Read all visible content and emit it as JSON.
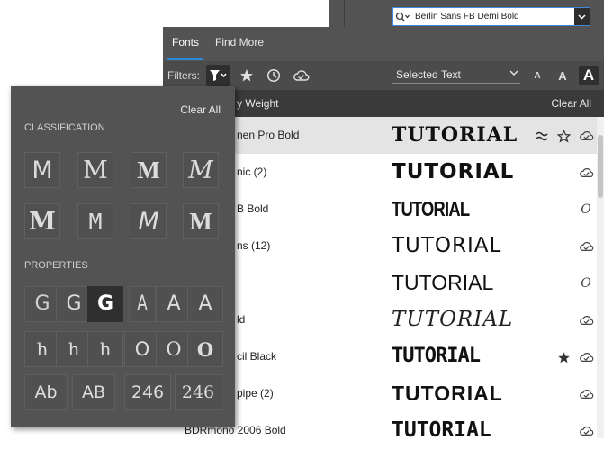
{
  "font_search": {
    "value": "Berlin Sans FB Demi Bold"
  },
  "tabs": [
    {
      "label": "Fonts",
      "active": true
    },
    {
      "label": "Find More",
      "active": false
    }
  ],
  "filters": {
    "label": "Filters:",
    "sample_text": "Selected Text",
    "sizes": [
      "A",
      "A",
      "A"
    ]
  },
  "list_header": {
    "sort_label": "y Weight",
    "clear_label": "Clear All"
  },
  "sample": "TUTORIAL",
  "font_rows": [
    {
      "name": "nen Pro Bold",
      "similar": true,
      "favorite": "outline",
      "sync": "cloud"
    },
    {
      "name": "nic (2)",
      "similar": false,
      "favorite": "none",
      "sync": "cloud"
    },
    {
      "name": "B Bold",
      "similar": false,
      "favorite": "none",
      "sync": "opentype"
    },
    {
      "name": "ns (12)",
      "similar": false,
      "favorite": "none",
      "sync": "cloud"
    },
    {
      "name": "",
      "similar": false,
      "favorite": "none",
      "sync": "opentype"
    },
    {
      "name": "ld",
      "similar": false,
      "favorite": "none",
      "sync": "cloud"
    },
    {
      "name": "cil Black",
      "similar": false,
      "favorite": "filled",
      "sync": "cloud"
    },
    {
      "name": "pipe (2)",
      "similar": false,
      "favorite": "none",
      "sync": "cloud"
    },
    {
      "name": "BDRmono 2006 Bold",
      "similar": false,
      "favorite": "none",
      "sync": "cloud"
    }
  ],
  "popup": {
    "clear_label": "Clear All",
    "classification_title": "CLASSIFICATION",
    "classification_glyphs": [
      "M",
      "M",
      "M",
      "M",
      "M",
      "M",
      "M",
      "M"
    ],
    "properties_title": "PROPERTIES",
    "properties": [
      [
        "G",
        "G",
        "G",
        "A",
        "A",
        "A"
      ],
      [
        "h",
        "h",
        "h",
        "O",
        "O",
        "O"
      ],
      [
        "Ab",
        "AB",
        "246",
        "246"
      ]
    ]
  },
  "colors": {
    "panel_dark": "#535353",
    "accent_blue": "#2c89e0",
    "selected_tile": "#2f2f2f"
  }
}
